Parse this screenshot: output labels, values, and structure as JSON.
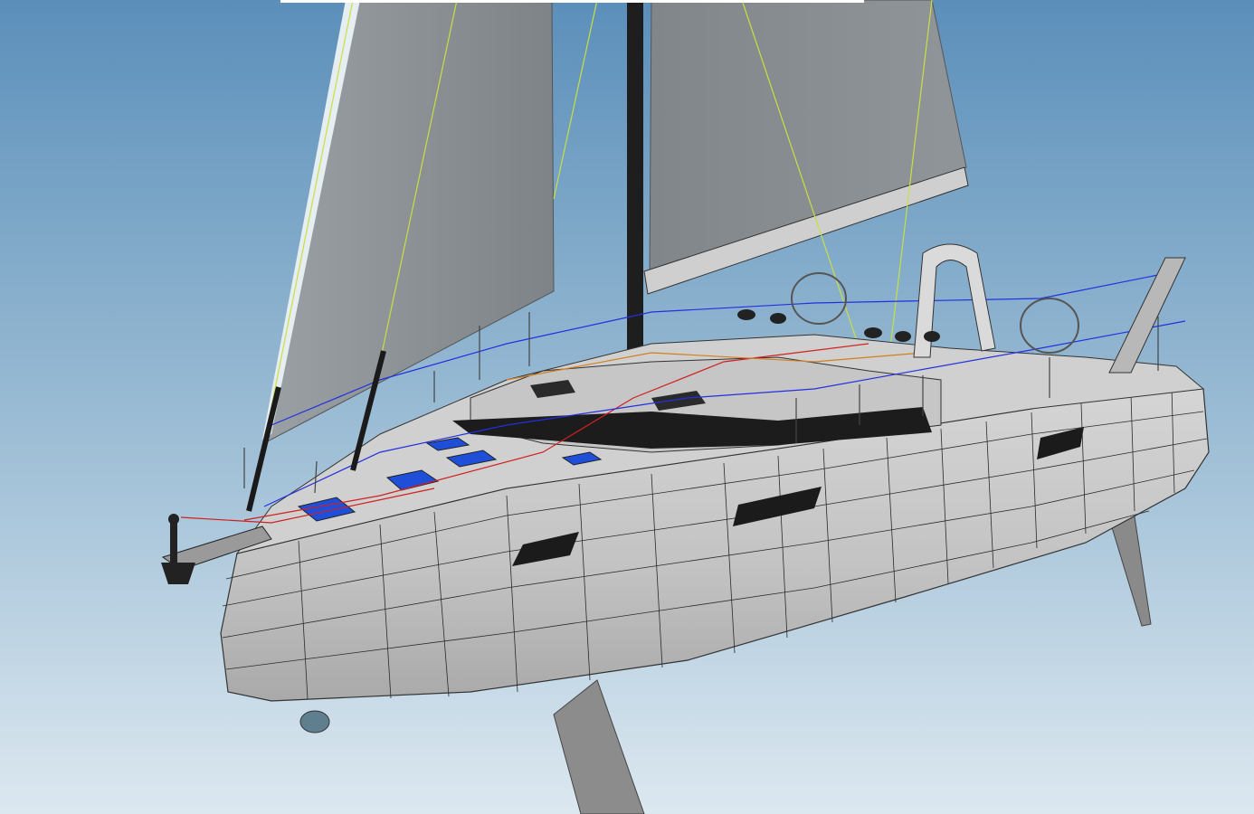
{
  "viewport": {
    "background_top": "#5b8fba",
    "background_bottom": "#dce8f0"
  },
  "model": {
    "hull_color": "#c9c9c9",
    "hull_shadow": "#9e9e9e",
    "deck_color": "#cfcfcf",
    "sail_color": "#8e9498",
    "sail_highlight": "#a7adb1",
    "mast_color": "#1e1e1e",
    "window_color": "#1b1b1b",
    "hatch_color": "#1f4fd8",
    "rigging_green": "#c8e040",
    "rigging_blue": "#2230e0",
    "rigging_red": "#d02020",
    "rigging_orange": "#d08020",
    "appendage_color": "#8a8a8a",
    "mesh_line_color": "#2a2a2a"
  }
}
